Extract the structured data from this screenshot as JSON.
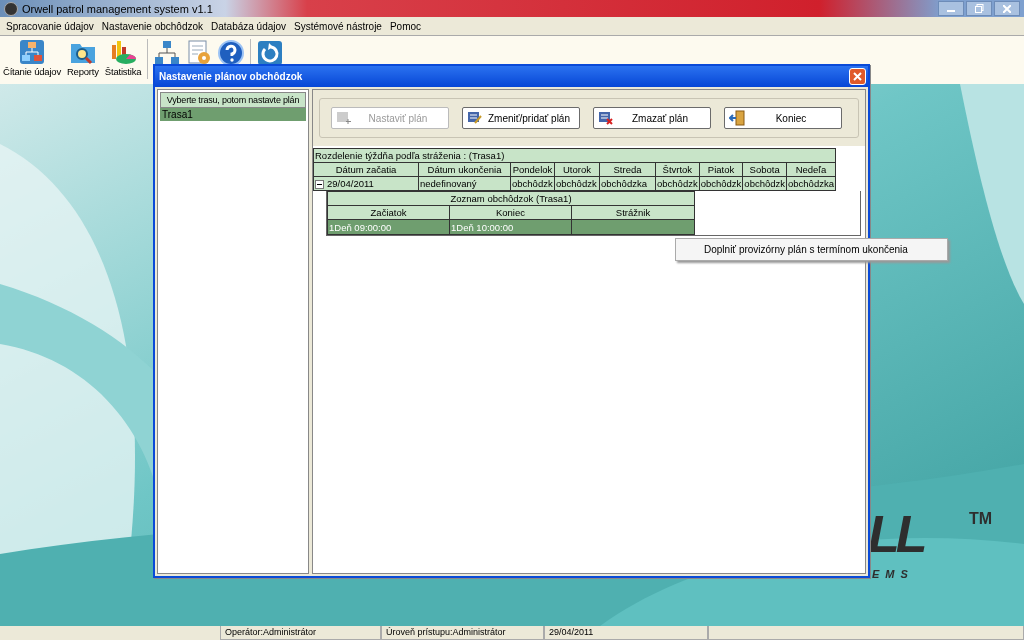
{
  "window": {
    "title": "Orwell patrol management system v1.1"
  },
  "menu": [
    "Spracovanie údajov",
    "Nastavenie obchôdzok",
    "Databáza údajov",
    "Systémové nástroje",
    "Pomoc"
  ],
  "toolbar": [
    "Čítanie údajov",
    "Reporty",
    "Štatistika"
  ],
  "dialog": {
    "title": "Nastavenie plánov obchôdzok",
    "route_list": {
      "header": "Vyberte trasu, potom nastavte plán",
      "items": [
        {
          "label": "Trasa1",
          "selected": true
        }
      ]
    },
    "buttons": [
      {
        "label": "Nastaviť plán",
        "disabled": true
      },
      {
        "label": "Zmeniť/pridať plán",
        "disabled": false
      },
      {
        "label": "Zmazať plán",
        "disabled": false
      },
      {
        "label": "Koniec",
        "disabled": false
      }
    ],
    "schedule": {
      "caption": "Rozdelenie týždňa podľa stráženia : (Trasa1)",
      "columns": [
        "Dátum začatia",
        "Dátum ukončenia",
        "Pondelok",
        "Utorok",
        "Streda",
        "Štvrtok",
        "Piatok",
        "Sobota",
        "Nedeľa"
      ],
      "rows": [
        {
          "expanded": true,
          "cells": [
            "29/04/2011",
            "nedefinovaný",
            "obchôdzk",
            "obchôdzk",
            "obchôdzka",
            "obchôdzk",
            "obchôdzk",
            "obchôdzk",
            "obchôdzka"
          ]
        }
      ]
    },
    "patrols": {
      "caption": "Zoznam obchôdzok  (Trasa1)",
      "columns": [
        "Začiatok",
        "Koniec",
        "Strážnik"
      ],
      "rows": [
        {
          "selected": true,
          "cells": [
            "1Deň  09:00:00",
            "1Deň  10:00:00"
          ]
        }
      ]
    }
  },
  "context_menu": {
    "items": [
      "Doplniť provizórny plán s termínom ukončenia"
    ]
  },
  "logo": {
    "letters": "LL",
    "mark": "TM",
    "subtitle": "EMS"
  },
  "status_bar": [
    "Operátor:Administrátor",
    "Úroveň prístupu:Administrátor",
    "29/04/2011"
  ]
}
